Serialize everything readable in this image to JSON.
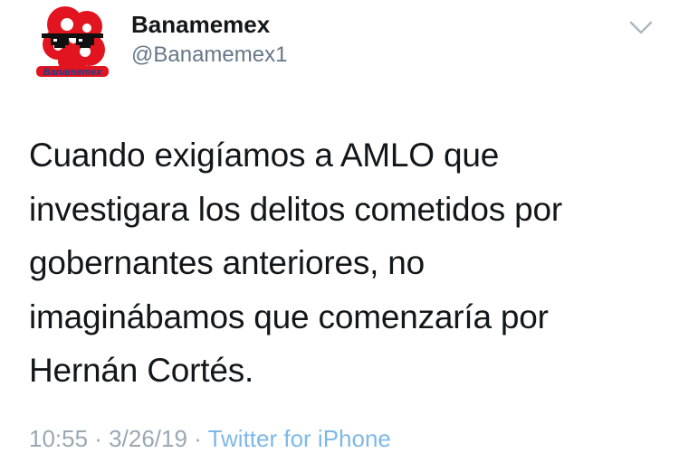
{
  "tweet": {
    "author": {
      "display_name": "Banamemex",
      "handle": "@Banamemex1",
      "avatar_icon": "banamemex-logo-icon",
      "avatar_logo_text": "Banamemex"
    },
    "menu_icon": "chevron-down-icon",
    "text": "Cuando exigíamos a AMLO que\ninvestigara los delitos cometidos por\ngobernantes anteriores, no\nimaginábamos que comenzaría por\nHernán Cortés.",
    "timestamp": "10:55 · 3/26/19 ·",
    "source": "Twitter for iPhone"
  },
  "colors": {
    "text": "#14171a",
    "secondary": "#657786",
    "link": "#1da1f2",
    "logo_red": "#e2141f"
  }
}
